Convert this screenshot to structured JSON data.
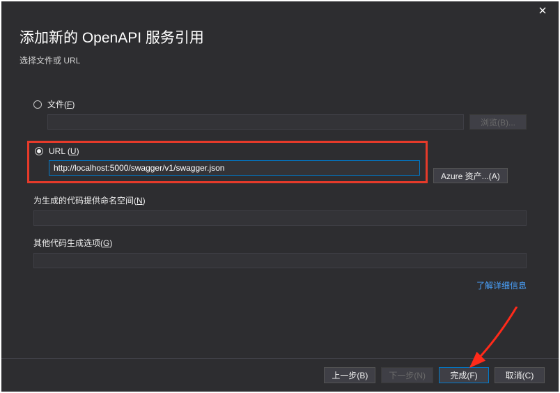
{
  "dialog": {
    "title": "添加新的 OpenAPI 服务引用",
    "subtitle": "选择文件或 URL"
  },
  "fileSection": {
    "radio_label_prefix": "文件(",
    "radio_hotkey": "F",
    "radio_label_suffix": ")",
    "value": "",
    "browse_label_prefix": "浏览(",
    "browse_hotkey": "B",
    "browse_label_suffix": ")..."
  },
  "urlSection": {
    "radio_label_prefix": "URL (",
    "radio_hotkey": "U",
    "radio_label_suffix": ")",
    "value": "http://localhost:5000/swagger/v1/swagger.json",
    "azure_label_prefix": "Azure 资产...(",
    "azure_hotkey": "A",
    "azure_label_suffix": ")"
  },
  "namespaceSection": {
    "label_prefix": "为生成的代码提供命名空间(",
    "hotkey": "N",
    "label_suffix": ")",
    "value": ""
  },
  "optionsSection": {
    "label_prefix": "其他代码生成选项(",
    "hotkey": "G",
    "label_suffix": ")",
    "value": ""
  },
  "link": {
    "label": "了解详细信息"
  },
  "footer": {
    "back_prefix": "上一步(",
    "back_hotkey": "B",
    "back_suffix": ")",
    "next_prefix": "下一步(",
    "next_hotkey": "N",
    "next_suffix": ")",
    "finish_prefix": "完成(",
    "finish_hotkey": "F",
    "finish_suffix": ")",
    "cancel_prefix": "取消(",
    "cancel_hotkey": "C",
    "cancel_suffix": ")"
  },
  "annotation": {
    "highlight_color": "#e63a2a",
    "arrow_color": "#ff2a1a"
  }
}
